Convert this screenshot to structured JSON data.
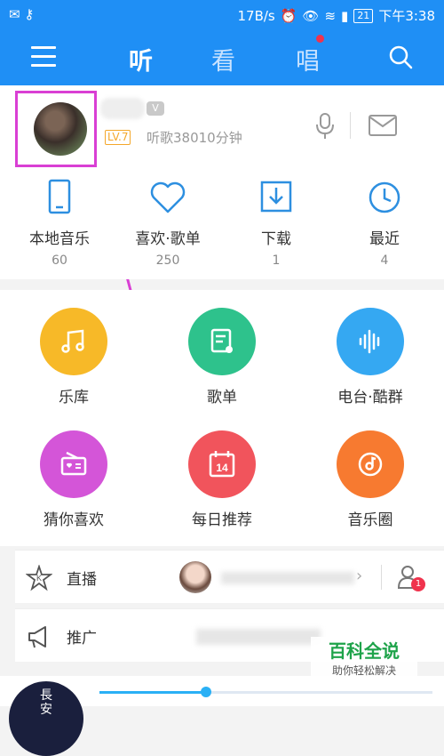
{
  "status": {
    "speed": "17B/s",
    "battery": "21",
    "time": "下午3:38"
  },
  "nav": {
    "tabs": [
      "听",
      "看",
      "唱"
    ],
    "active_tab": "听"
  },
  "profile": {
    "level": "LV.7",
    "listen_time": "听歌38010分钟"
  },
  "quick_items": [
    {
      "label": "本地音乐",
      "count": "60",
      "icon": "phone-icon"
    },
    {
      "label": "喜欢·歌单",
      "count": "250",
      "icon": "heart-icon"
    },
    {
      "label": "下载",
      "count": "1",
      "icon": "download-icon"
    },
    {
      "label": "最近",
      "count": "4",
      "icon": "clock-icon"
    }
  ],
  "grid_items": [
    {
      "label": "乐库",
      "color": "#f7b928",
      "icon": "music-note-icon"
    },
    {
      "label": "歌单",
      "color": "#2ec28c",
      "icon": "playlist-icon"
    },
    {
      "label": "电台·酷群",
      "color": "#35a8f2",
      "icon": "soundwave-icon"
    },
    {
      "label": "猜你喜欢",
      "color": "#d455d8",
      "icon": "radio-icon"
    },
    {
      "label": "每日推荐",
      "color": "#f1545c",
      "icon": "calendar-icon"
    },
    {
      "label": "音乐圈",
      "color": "#f77a30",
      "icon": "disc-icon"
    }
  ],
  "calendar_day": "14",
  "rows": {
    "live": "直播",
    "promo": "推广"
  },
  "notification_count": "1",
  "watermark": {
    "title": "百科全说",
    "subtitle": "助你轻松解决"
  },
  "album_text": "長\n安",
  "player": {
    "progress": 0.32
  }
}
